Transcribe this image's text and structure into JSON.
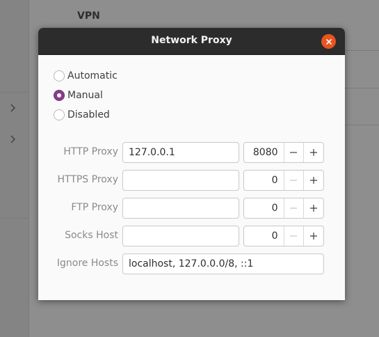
{
  "background": {
    "section_title": "VPN"
  },
  "dialog": {
    "title": "Network Proxy",
    "modes": [
      {
        "label": "Automatic",
        "checked": false
      },
      {
        "label": "Manual",
        "checked": true
      },
      {
        "label": "Disabled",
        "checked": false
      }
    ],
    "fields": {
      "http": {
        "label": "HTTP Proxy",
        "host": "127.0.0.1",
        "port": "8080"
      },
      "https": {
        "label": "HTTPS Proxy",
        "host": "",
        "port": "0"
      },
      "ftp": {
        "label": "FTP Proxy",
        "host": "",
        "port": "0"
      },
      "socks": {
        "label": "Socks Host",
        "host": "",
        "port": "0"
      },
      "ignore": {
        "label": "Ignore Hosts",
        "value": "localhost, 127.0.0.0/8, ::1"
      }
    }
  },
  "colors": {
    "accent": "#e95420",
    "radio_checked": "#8a3d8c",
    "titlebar": "#2c2c2c"
  }
}
